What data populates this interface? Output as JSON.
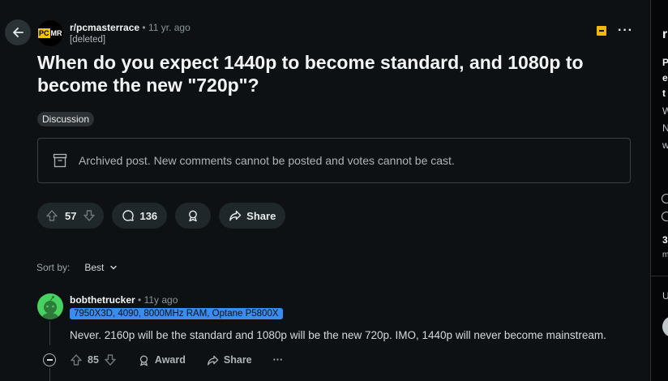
{
  "post": {
    "subreddit": "r/pcmasterrace",
    "subreddit_logo_text_left": "PC",
    "subreddit_logo_text_right": "MR",
    "separator": "•",
    "age": "11 yr. ago",
    "author": "[deleted]",
    "title": "When do you expect 1440p to become standard, and 1080p to become the new \"720p\"?",
    "flair": "Discussion",
    "archived_notice": "Archived post. New comments cannot be posted and votes cannot be cast.",
    "votes": "57",
    "comments": "136",
    "share_label": "Share"
  },
  "sort": {
    "label": "Sort by:",
    "value": "Best"
  },
  "comment": {
    "author": "bobthetrucker",
    "separator": "•",
    "age": "11y ago",
    "user_flair": "7950X3D, 4090, 8000MHz RAM, Optane P5800X",
    "body": "Never. 2160p will be the standard and 1080p will be the new 720p. IMO, 1440p will never become mainstream.",
    "votes": "85",
    "award_label": "Award",
    "share_label": "Share",
    "more": "···"
  },
  "right_sidebar": {
    "title_char": "r",
    "lines": [
      "P",
      "e",
      "t",
      "W",
      "N",
      "w"
    ],
    "stat": "3",
    "stat_sub": "m",
    "section_char": "U"
  },
  "colors": {
    "background": "#0e1113",
    "user_flair": "#3a8df0",
    "logo_yellow": "#f5c400",
    "comment_avatar": "#46d160",
    "archive_icon": "#f0b90b"
  },
  "icons": [
    "back-arrow-icon",
    "archive-icon",
    "more-icon",
    "upvote-icon",
    "downvote-icon",
    "comment-icon",
    "award-icon",
    "share-icon",
    "chevron-down-icon",
    "collapse-icon"
  ]
}
